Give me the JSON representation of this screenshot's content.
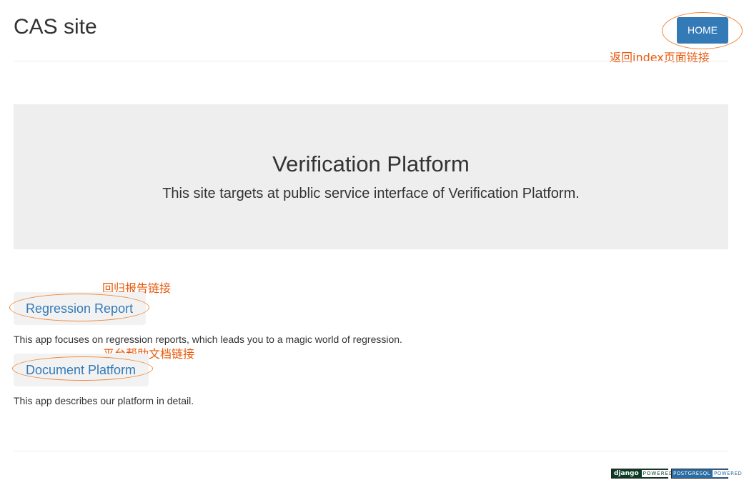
{
  "header": {
    "site_title": "CAS site",
    "home_label": "HOME",
    "home_annotation": "返回index页面链接"
  },
  "jumbotron": {
    "title": "Verification Platform",
    "subtitle": "This site targets at public service interface of Verification Platform."
  },
  "apps": [
    {
      "label": "Regression Report",
      "description": "This app focuses on regression reports, which leads you to a magic world of regression.",
      "annotation": "回归报告链接"
    },
    {
      "label": "Document Platform",
      "description": "This app describes our platform in detail.",
      "annotation": "平台帮助文档链接"
    }
  ],
  "footer": {
    "django_badge": {
      "brand": "django",
      "tag": "POWERED"
    },
    "postgres_badge": {
      "brand": "POSTGRESQL",
      "tag": "POWERED"
    }
  },
  "colors": {
    "primary": "#337ab7",
    "annotation": "#e8590c",
    "jumbotron_bg": "#eeeeee"
  }
}
